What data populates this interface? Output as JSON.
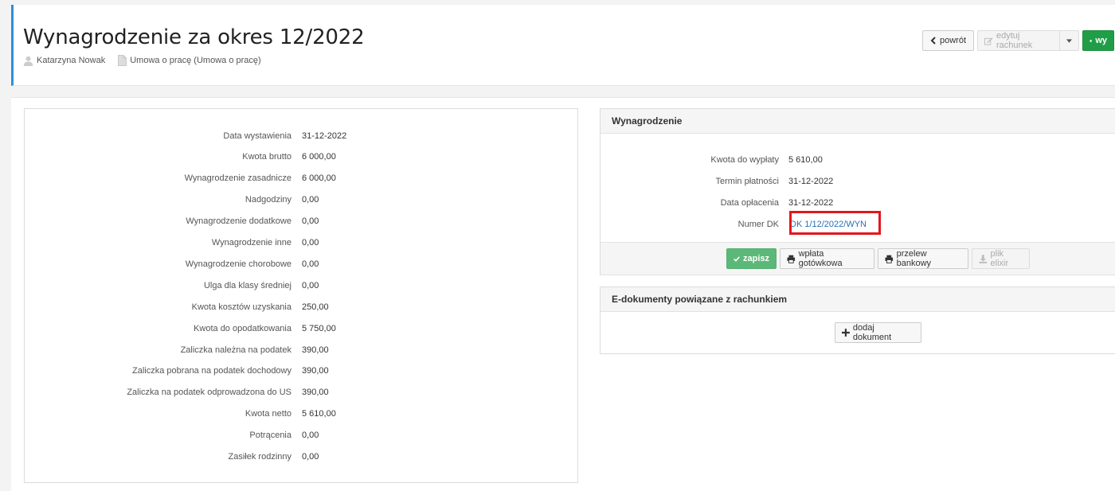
{
  "header": {
    "title": "Wynagrodzenie za okres 12/2022",
    "employee": "Katarzyna Nowak",
    "contract": "Umowa o pracę (Umowa o pracę)",
    "actions": {
      "back": "powrót",
      "edit": "edytuj rachunek",
      "print_partial": "wy"
    }
  },
  "details": [
    {
      "label": "Data wystawienia",
      "value": "31-12-2022"
    },
    {
      "label": "Kwota brutto",
      "value": "6 000,00"
    },
    {
      "label": "Wynagrodzenie zasadnicze",
      "value": "6 000,00"
    },
    {
      "label": "Nadgodziny",
      "value": "0,00"
    },
    {
      "label": "Wynagrodzenie dodatkowe",
      "value": "0,00"
    },
    {
      "label": "Wynagrodzenie inne",
      "value": "0,00"
    },
    {
      "label": "Wynagrodzenie chorobowe",
      "value": "0,00"
    },
    {
      "label": "Ulga dla klasy średniej",
      "value": "0,00"
    },
    {
      "label": "Kwota kosztów uzyskania",
      "value": "250,00"
    },
    {
      "label": "Kwota do opodatkowania",
      "value": "5 750,00"
    },
    {
      "label": "Zaliczka należna na podatek",
      "value": "390,00"
    },
    {
      "label": "Zaliczka pobrana na podatek dochodowy",
      "value": "390,00"
    },
    {
      "label": "Zaliczka na podatek odprowadzona do US",
      "value": "390,00"
    },
    {
      "label": "Kwota netto",
      "value": "5 610,00"
    },
    {
      "label": "Potrącenia",
      "value": "0,00"
    },
    {
      "label": "Zasiłek rodzinny",
      "value": "0,00"
    }
  ],
  "wynagrodzenie_panel": {
    "title": "Wynagrodzenie",
    "rows": [
      {
        "label": "Kwota do wypłaty",
        "value": "5 610,00"
      },
      {
        "label": "Termin płatności",
        "value": "31-12-2022"
      },
      {
        "label": "Data opłacenia",
        "value": "31-12-2022"
      },
      {
        "label": "Numer DK",
        "value": "DK 1/12/2022/WYN"
      }
    ],
    "buttons": {
      "save": "zapisz",
      "cash": "wpłata gotówkowa",
      "bank": "przelew bankowy",
      "elixir": "plik elixir"
    }
  },
  "edocs_panel": {
    "title": "E-dokumenty powiązane z rachunkiem",
    "add_button": "dodaj dokument"
  },
  "colors": {
    "accent_border": "#2d8fd6",
    "print_button": "#1f9e47",
    "save_button": "#5cb878",
    "highlight": "#e3161c",
    "link": "#2a6fb8"
  }
}
